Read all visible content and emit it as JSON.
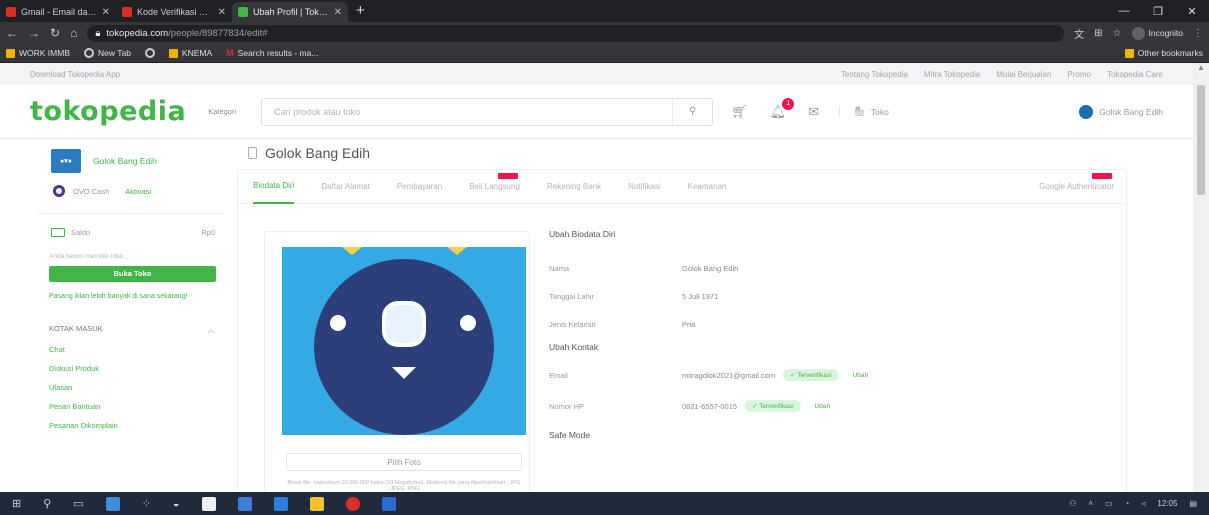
{
  "browser": {
    "tabs": [
      {
        "label": "Gmail - Email dari Google"
      },
      {
        "label": "Kode Verifikasi untuk Sentuh Email"
      },
      {
        "label": "Ubah Profil | Tokopedia"
      }
    ],
    "url_host": "tokopedia.com",
    "url_path": "/people/89877834/edit#",
    "profile_label": "Incognito",
    "bookmarks": [
      "WORK IMMB",
      "New Tab",
      "",
      "KNEMA",
      "Search results - ma..."
    ],
    "other_bookmarks": "Other bookmarks"
  },
  "topstrip": {
    "download": "Download Tokopedia App",
    "links": [
      "Tentang Tokopedia",
      "Mitra Tokopedia",
      "Mulai Berjualan",
      "Promo",
      "Tokopedia Care"
    ]
  },
  "header": {
    "logo": "tokopedia",
    "category": "Kategori",
    "search_placeholder": "Cari produk atau toko",
    "notif_count": "1",
    "toko": "Toko",
    "user_name": "Golok Bang Edih"
  },
  "sidebar": {
    "name": "Golok Bang Edih",
    "ovo": "OVO Cash",
    "ovo_action": "Aktivasi",
    "saldo": "Saldo",
    "saldo_value": "Rp0",
    "note": "Anda belum memiliki toko.",
    "open_shop": "Buka Toko",
    "link": "Pasang iklan lebih banyak di sana sekarang!",
    "section": "KOTAK MASUK",
    "items": [
      "Chat",
      "Diskusi Produk",
      "Ulasan",
      "Pesan Bantuan",
      "Pesanan Dikomplain"
    ]
  },
  "main": {
    "title": "Golok Bang Edih",
    "tabs": [
      "Biodata Diri",
      "Daftar Alamat",
      "Pembayaran",
      "Beli Langsung",
      "Rekening Bank",
      "Notifikasi",
      "Keamanan",
      "Google Authenticator"
    ],
    "choose_photo": "Pilih Foto",
    "photo_note": "Besar file: maksimum 10.000.000 bytes (10 Megabytes). Ekstensi file yang diperbolehkan: .JPG .JPEG .PNG",
    "bio_heading": "Ubah Biodata Diri",
    "fields": [
      {
        "label": "Nama",
        "value": "Golok Bang Edih"
      },
      {
        "label": "Tanggal Lahir",
        "value": "5 Juli 1971"
      },
      {
        "label": "Jenis Kelamin",
        "value": "Pria"
      }
    ],
    "contact_heading": "Ubah Kontak",
    "email_label": "Email",
    "email_value": "mitragolok2021@gmail.com",
    "phone_label": "Nomor HP",
    "phone_value": "0821-6557-0015",
    "verified": "✓ Terverifikasi",
    "change": "Ubah",
    "safe_mode": "Safe Mode"
  },
  "taskbar": {
    "time": "12:05"
  },
  "colors": {
    "brand_green": "#42b549",
    "badge_red": "#ef144a",
    "avatar_blue": "#2ea7e0"
  }
}
